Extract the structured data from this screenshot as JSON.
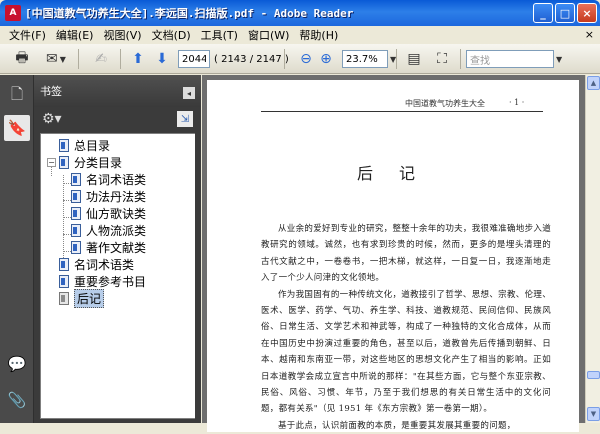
{
  "window": {
    "title": "[中国道教气功养生大全].李远国.扫描版.pdf - Adobe Reader",
    "app_icon": "adobe-reader-icon",
    "controls": [
      "minimize",
      "maximize",
      "close"
    ]
  },
  "menu": {
    "items": [
      "文件(F)",
      "编辑(E)",
      "视图(V)",
      "文档(D)",
      "工具(T)",
      "窗口(W)",
      "帮助(H)"
    ],
    "close_glyph": "×"
  },
  "toolbar": {
    "current_page": "2044",
    "page_total": "( 2143 / 2147 )",
    "zoom": "23.7%",
    "search_placeholder": "查找"
  },
  "rail": {
    "buttons": [
      "pages-icon",
      "bookmarks-icon",
      "comments-icon",
      "attachments-icon"
    ],
    "active": "bookmarks-icon"
  },
  "bookmarks": {
    "header": "书签",
    "items": [
      {
        "label": "总目录",
        "level": 0,
        "expander": ""
      },
      {
        "label": "分类目录",
        "level": 0,
        "expander": "−"
      },
      {
        "label": "名词术语类",
        "level": 1,
        "expander": ""
      },
      {
        "label": "功法丹法类",
        "level": 1,
        "expander": ""
      },
      {
        "label": "仙方歌诀类",
        "level": 1,
        "expander": ""
      },
      {
        "label": "人物流派类",
        "level": 1,
        "expander": ""
      },
      {
        "label": "著作文献类",
        "level": 1,
        "expander": ""
      },
      {
        "label": "名词术语类",
        "level": 0,
        "expander": ""
      },
      {
        "label": "重要参考书目",
        "level": 0,
        "expander": ""
      },
      {
        "label": "后记",
        "level": 0,
        "expander": "",
        "selected": true
      }
    ]
  },
  "document": {
    "running_head": "中国道教气功养生大全",
    "page_number": "· 1 ·",
    "chapter_title": "后记",
    "paragraphs": [
      "从业余的爱好到专业的研究，整整十余年的功夫，我很难准确地步入道教研究的领域。诚然，也有求到珍贵的时候，然而，更多的是埋头清理的古代文献之中，一卷卷书，一把木梯，就这样，一日复一日，我逐渐地走入了一个少人问津的文化领地。",
      "作为我国固有的一种传统文化，道教接引了哲学、思想、宗教、伦理、医术、医学、药学、气功、养生学、科技、道教规范、民间信仰、民族风俗、日常生活、文学艺术和神武等，构成了一种独特的文化合成体，从而在中国历史中扮演过重要的角色，甚至以后，道教曾先后传播到朝鲜、日本、越南和东南亚一带，对这些地区的思想文化产生了相当的影响。正如日本道教学会成立宣言中所说的那样：\"在其些方面，它与整个东亚宗教、民俗、风俗、习惯、年节，乃至于我们想思的有关日常生活中的文化问题，都有关系\"（见 1951 年《东方宗教》第一卷第一期）。",
      "基于此点，认识前面教的本质，是重要其发展其重要的问题，"
    ]
  }
}
